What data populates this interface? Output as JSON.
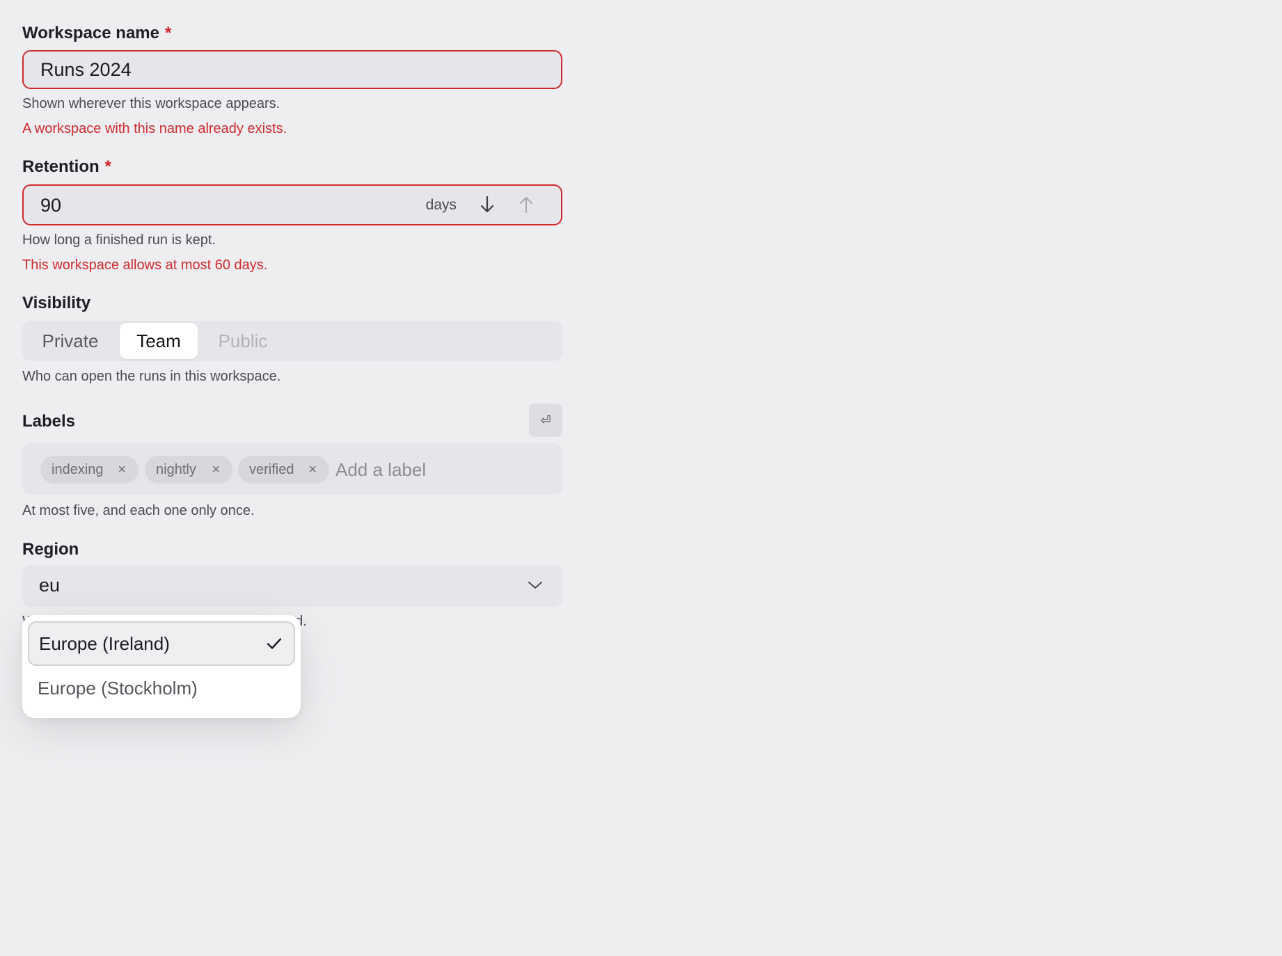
{
  "workspace_name": {
    "label": "Workspace name",
    "required_mark": "*",
    "value": "Runs 2024",
    "helper": "Shown wherever this workspace appears.",
    "error": "A workspace with this name already exists."
  },
  "retention": {
    "label": "Retention",
    "required_mark": "*",
    "value": "90",
    "unit": "days",
    "decrement_icon": "arrow-down-icon",
    "increment_icon": "arrow-up-icon",
    "helper": "How long a finished run is kept.",
    "error": "This workspace allows at most 60 days."
  },
  "visibility": {
    "label": "Visibility",
    "options": [
      {
        "label": "Private",
        "state": "enabled"
      },
      {
        "label": "Team",
        "state": "selected"
      },
      {
        "label": "Public",
        "state": "disabled"
      }
    ],
    "helper": "Who can open the runs in this workspace."
  },
  "labels": {
    "label": "Labels",
    "action_icon": "enter-icon",
    "action_glyph": "⏎",
    "chips": [
      {
        "text": "indexing",
        "remove": "×"
      },
      {
        "text": "nightly",
        "remove": "×"
      },
      {
        "text": "verified",
        "remove": "×"
      }
    ],
    "placeholder": "Add a label",
    "helper": "At most five, and each one only once."
  },
  "region": {
    "label": "Region",
    "value": "eu",
    "chevron_icon": "chevron-down-icon",
    "helper_visible_start": "W",
    "helper_visible_end": "ed.",
    "options": [
      {
        "label": "Europe (Ireland)",
        "selected": true
      },
      {
        "label": "Europe (Stockholm)",
        "selected": false
      }
    ]
  },
  "colors": {
    "error": "#cf2a30",
    "background": "#eeedf0",
    "field": "#e6e5e9"
  }
}
